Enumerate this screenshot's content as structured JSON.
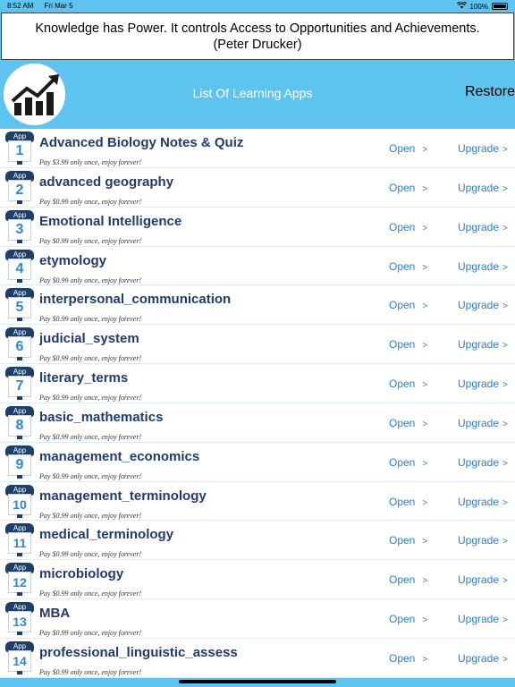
{
  "status_bar": {
    "time": "8:52 AM",
    "date": "Fri Mar 5",
    "battery": "100%",
    "battery_level": 1.0,
    "wifi_icon": "wifi-icon"
  },
  "quote": {
    "text_line1": "Knowledge has Power. It controls Access to Opportunities and Achievements.",
    "text_line2": "(Peter Drucker)"
  },
  "header": {
    "title": "List Of Learning Apps",
    "restore_label": "Restore",
    "logo_icon": "trending-up-chart-icon"
  },
  "colors": {
    "header_bg": "#5ec4ef",
    "app_name": "#233a6d",
    "link": "#2e7ccf",
    "badge_dark": "#1f3f6b",
    "badge_number": "#2f86d6"
  },
  "badge_label": "App",
  "open_label": "Open",
  "upgrade_label": "Upgrade",
  "chevron": ">",
  "apps": [
    {
      "number": "1",
      "name": "Advanced Biology Notes & Quiz",
      "price": "Pay $3.99 only once, enjoy forever!"
    },
    {
      "number": "2",
      "name": "advanced geography",
      "price": "Pay $0.99 only once, enjoy forever!"
    },
    {
      "number": "3",
      "name": "Emotional Intelligence",
      "price": "Pay $0.99 only once, enjoy forever!"
    },
    {
      "number": "4",
      "name": "etymology",
      "price": "Pay $0.99 only once, enjoy forever!"
    },
    {
      "number": "5",
      "name": "interpersonal_communication",
      "price": "Pay $0.99 only once, enjoy forever!"
    },
    {
      "number": "6",
      "name": "judicial_system",
      "price": "Pay $0.99 only once, enjoy forever!"
    },
    {
      "number": "7",
      "name": "literary_terms",
      "price": "Pay $0.99 only once, enjoy forever!"
    },
    {
      "number": "8",
      "name": "basic_mathematics",
      "price": "Pay $0.99 only once, enjoy forever!"
    },
    {
      "number": "9",
      "name": "management_economics",
      "price": "Pay $0.99 only once, enjoy forever!"
    },
    {
      "number": "10",
      "name": "management_terminology",
      "price": "Pay $0.99 only once, enjoy forever!"
    },
    {
      "number": "11",
      "name": "medical_terminology",
      "price": "Pay $0.99 only once, enjoy forever!"
    },
    {
      "number": "12",
      "name": "microbiology",
      "price": "Pay $0.99 only once, enjoy forever!"
    },
    {
      "number": "13",
      "name": "MBA",
      "price": "Pay $0.99 only once, enjoy forever!"
    },
    {
      "number": "14",
      "name": "professional_linguistic_assess",
      "price": "Pay $0.99 only once, enjoy forever!"
    }
  ]
}
